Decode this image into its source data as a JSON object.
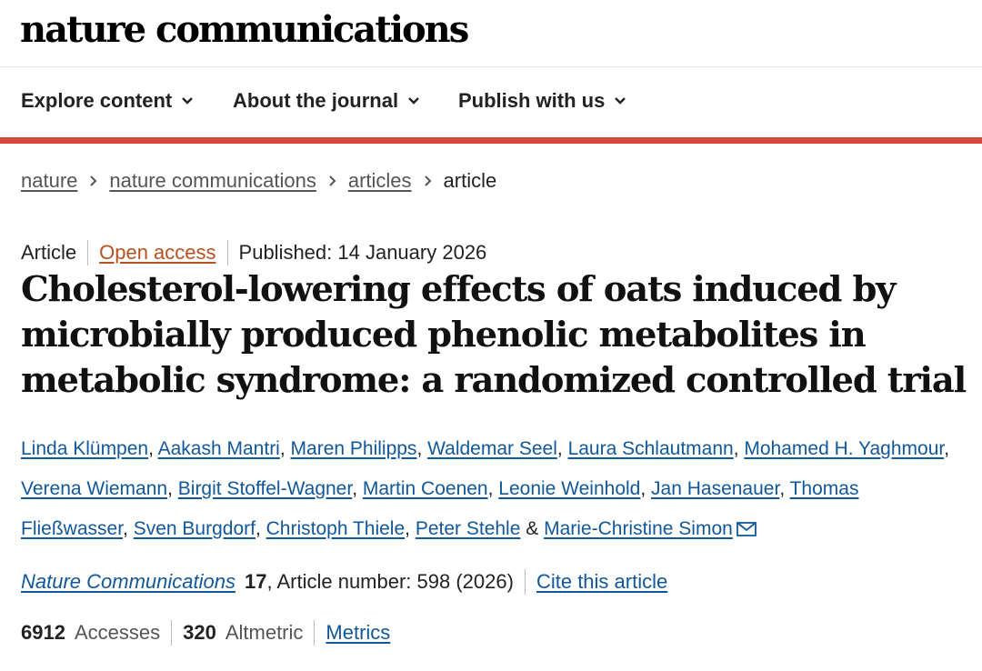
{
  "header": {
    "logo": "nature communications"
  },
  "nav": [
    {
      "label": "Explore content"
    },
    {
      "label": "About the journal"
    },
    {
      "label": "Publish with us"
    }
  ],
  "breadcrumb": {
    "items": [
      "nature",
      "nature communications",
      "articles"
    ],
    "current": "article"
  },
  "article": {
    "type": "Article",
    "access": "Open access",
    "published": "Published: 14 January 2026",
    "title": "Cholesterol-lowering effects of oats induced by microbially produced phenolic metabolites in metabolic syndrome: a randomized controlled trial",
    "authors": [
      "Linda Klümpen",
      "Aakash Mantri",
      "Maren Philipps",
      "Waldemar Seel",
      "Laura Schlautmann",
      "Mohamed H. Yaghmour",
      "Verena Wiemann",
      "Birgit Stoffel-Wagner",
      "Martin Coenen",
      "Leonie Weinhold",
      "Jan Hasenauer",
      "Thomas Fließwasser",
      "Sven Burgdorf",
      "Christoph Thiele",
      "Peter Stehle",
      "Marie-Christine Simon"
    ],
    "author_separator": ", ",
    "last_separator": " & ",
    "journal": "Nature Communications",
    "volume": "17",
    "article_number": ", Article number: 598 (2026)",
    "cite_label": "Cite this article"
  },
  "metrics": {
    "accesses_count": "6912",
    "accesses_label": "Accesses",
    "altmetric_count": "320",
    "altmetric_label": "Altmetric",
    "metrics_link": "Metrics"
  },
  "colors": {
    "link": "#11589b",
    "accent_bar": "#d5483b",
    "open_access": "#b7511f"
  },
  "icons": [
    "chevron-down-icon",
    "chevron-right-icon",
    "mail-icon"
  ]
}
